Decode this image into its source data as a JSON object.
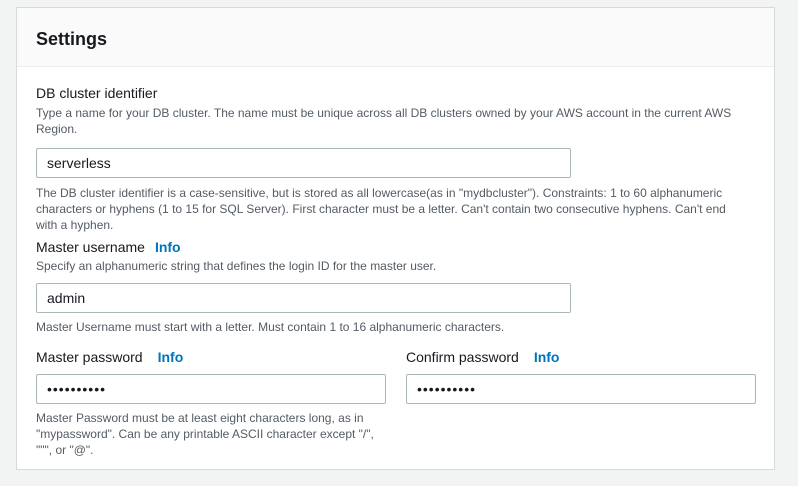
{
  "panel": {
    "title": "Settings"
  },
  "cluster_identifier": {
    "label": "DB cluster identifier",
    "description": "Type a name for your DB cluster. The name must be unique across all DB clusters owned by your AWS account in the current AWS Region.",
    "value": "serverless",
    "constraint": "The DB cluster identifier is a case-sensitive, but is stored as all lowercase(as in \"mydbcluster\"). Constraints: 1 to 60 alphanumeric characters or hyphens (1 to 15 for SQL Server). First character must be a letter. Can't contain two consecutive hyphens. Can't end with a hyphen."
  },
  "master_username": {
    "label": "Master username",
    "info_label": "Info",
    "description": "Specify an alphanumeric string that defines the login ID for the master user.",
    "value": "admin",
    "constraint": "Master Username must start with a letter. Must contain 1 to 16 alphanumeric characters."
  },
  "master_password": {
    "label": "Master password",
    "info_label": "Info",
    "value": "••••••••••",
    "constraint": "Master Password must be at least eight characters long, as in \"mypassword\". Can be any printable ASCII character except \"/\", \"\"\", or \"@\"."
  },
  "confirm_password": {
    "label": "Confirm password",
    "info_label": "Info",
    "value": "••••••••••"
  }
}
